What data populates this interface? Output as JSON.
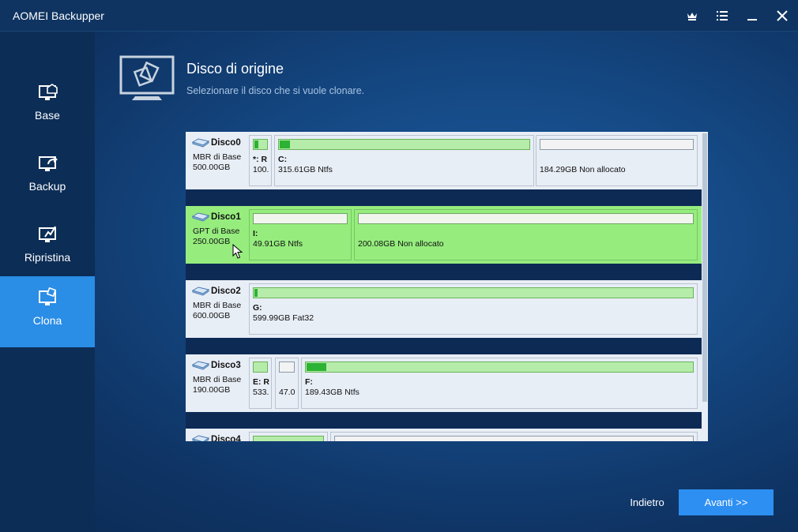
{
  "window": {
    "title": "AOMEI Backupper",
    "controls": [
      {
        "name": "upgrade-crown-icon"
      },
      {
        "name": "menu-list-icon"
      },
      {
        "name": "minimize-icon"
      },
      {
        "name": "close-icon"
      }
    ]
  },
  "sidebar": {
    "items": [
      {
        "label": "Base",
        "icon": "home-monitor-icon",
        "active": false
      },
      {
        "label": "Backup",
        "icon": "backup-monitor-icon",
        "active": false
      },
      {
        "label": "Ripristina",
        "icon": "restore-monitor-icon",
        "active": false
      },
      {
        "label": "Clona",
        "icon": "clone-monitor-icon",
        "active": true
      }
    ]
  },
  "header": {
    "title": "Disco di origine",
    "subtitle": "Selezionare il disco che si vuole clonare."
  },
  "disks": [
    {
      "name": "Disco0",
      "type": "MBR di Base",
      "size": "500.00GB",
      "selected": false,
      "partitions": [
        {
          "letter": "*: R",
          "info": "100.",
          "fill": 0.3,
          "kind": "ntfs"
        },
        {
          "letter": "C:",
          "info": "315.61GB Ntfs",
          "fill": 0.04,
          "kind": "ntfs"
        },
        {
          "letter": "",
          "info": "184.29GB Non allocato",
          "fill": 0,
          "kind": "unalloc"
        }
      ]
    },
    {
      "name": "Disco1",
      "type": "GPT di Base",
      "size": "250.00GB",
      "selected": true,
      "partitions": [
        {
          "letter": "I:",
          "info": "49.91GB Ntfs",
          "fill": 0,
          "kind": "ntfs"
        },
        {
          "letter": "",
          "info": "200.08GB Non allocato",
          "fill": 0,
          "kind": "unalloc"
        }
      ]
    },
    {
      "name": "Disco2",
      "type": "MBR di Base",
      "size": "600.00GB",
      "selected": false,
      "partitions": [
        {
          "letter": "G:",
          "info": "599.99GB Fat32",
          "fill": 0.008,
          "kind": "ntfs"
        }
      ]
    },
    {
      "name": "Disco3",
      "type": "MBR di Base",
      "size": "190.00GB",
      "selected": false,
      "partitions": [
        {
          "letter": "E: R",
          "info": "533.",
          "fill": 0,
          "kind": "ntfs"
        },
        {
          "letter": "",
          "info": "47.0",
          "fill": 0,
          "kind": "unalloc"
        },
        {
          "letter": "F:",
          "info": "189.43GB Ntfs",
          "fill": 0.05,
          "kind": "ntfs"
        }
      ]
    },
    {
      "name": "Disco4",
      "type": "",
      "size": "",
      "selected": false,
      "partitions": [
        {
          "letter": "",
          "info": "",
          "fill": 0,
          "kind": "ntfs"
        },
        {
          "letter": "",
          "info": "",
          "fill": 0,
          "kind": "unalloc"
        }
      ]
    }
  ],
  "footer": {
    "back_label": "Indietro",
    "next_label": "Avanti >>"
  }
}
